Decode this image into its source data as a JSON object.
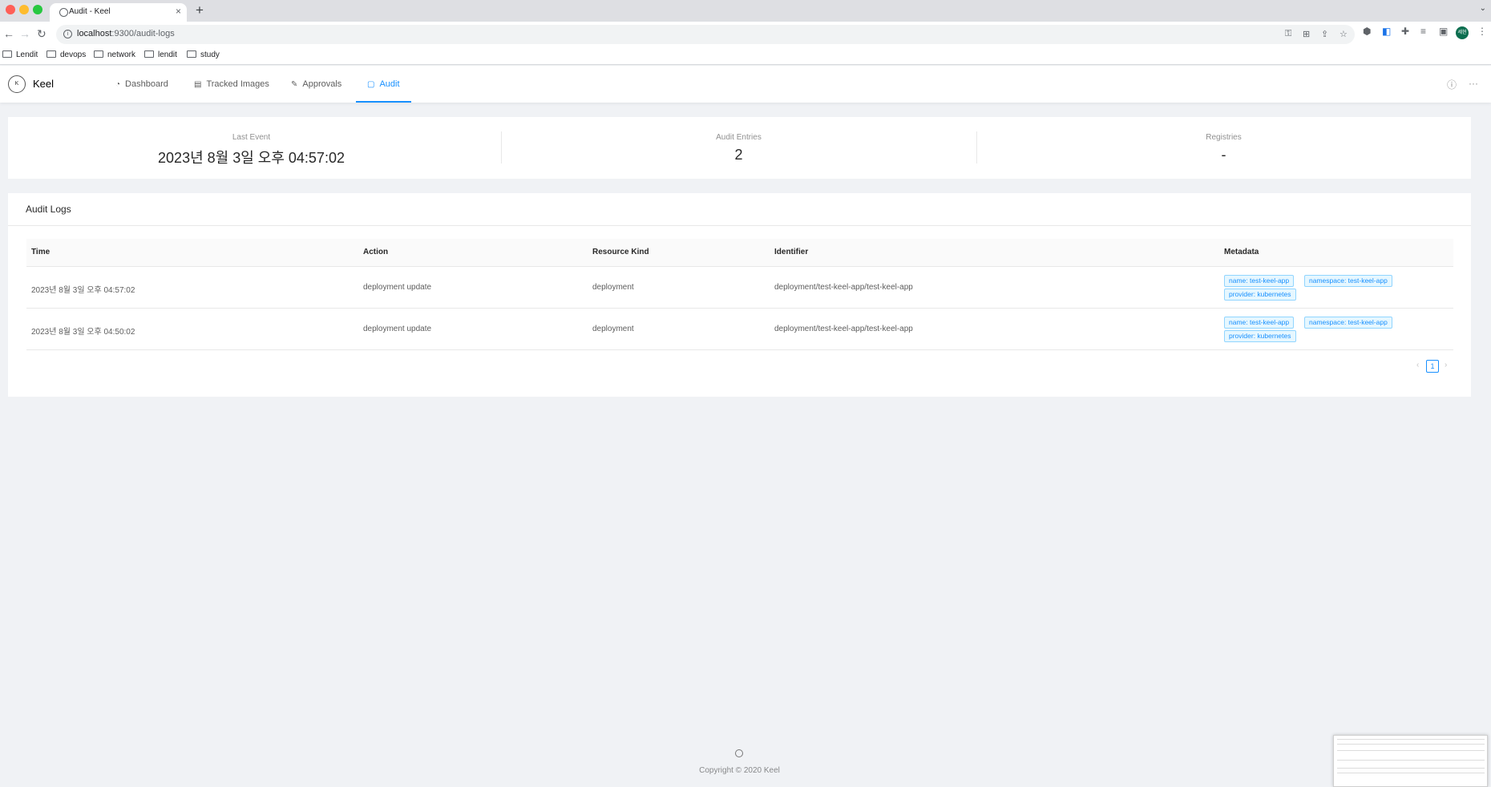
{
  "browser": {
    "tab_title": "Audit - Keel",
    "tab_close": "×",
    "new_tab": "+",
    "url_host": "localhost",
    "url_rest": ":9300/audit-logs",
    "bookmarks": [
      "Lendit",
      "devops",
      "network",
      "lendit",
      "study"
    ],
    "profile_label": "세현"
  },
  "app": {
    "brand": "Keel",
    "logo_letter": "K",
    "nav": [
      {
        "label": "Dashboard",
        "icon": "dashboard-icon"
      },
      {
        "label": "Tracked Images",
        "icon": "image-icon"
      },
      {
        "label": "Approvals",
        "icon": "edit-icon"
      },
      {
        "label": "Audit",
        "icon": "file-icon",
        "active": true
      }
    ]
  },
  "stats": {
    "last_event": {
      "label": "Last Event",
      "value": "2023년 8월 3일 오후 04:57:02"
    },
    "audit_entries": {
      "label": "Audit Entries",
      "value": "2"
    },
    "registries": {
      "label": "Registries",
      "value": "-"
    }
  },
  "audit_logs": {
    "title": "Audit Logs",
    "columns": [
      "Time",
      "Action",
      "Resource Kind",
      "Identifier",
      "Metadata"
    ],
    "rows": [
      {
        "time": "2023년 8월 3일 오후 04:57:02",
        "action": "deployment update",
        "resource_kind": "deployment",
        "identifier": "deployment/test-keel-app/test-keel-app",
        "metadata": [
          "name: test-keel-app",
          "namespace: test-keel-app",
          "provider: kubernetes"
        ]
      },
      {
        "time": "2023년 8월 3일 오후 04:50:02",
        "action": "deployment update",
        "resource_kind": "deployment",
        "identifier": "deployment/test-keel-app/test-keel-app",
        "metadata": [
          "name: test-keel-app",
          "namespace: test-keel-app",
          "provider: kubernetes"
        ]
      }
    ],
    "pagination": {
      "current_page": "1",
      "prev": "‹",
      "next": "›"
    }
  },
  "footer": {
    "copyright": "Copyright © 2020 Keel"
  },
  "colors": {
    "accent": "#1890ff",
    "page_bg": "#f0f2f5"
  }
}
